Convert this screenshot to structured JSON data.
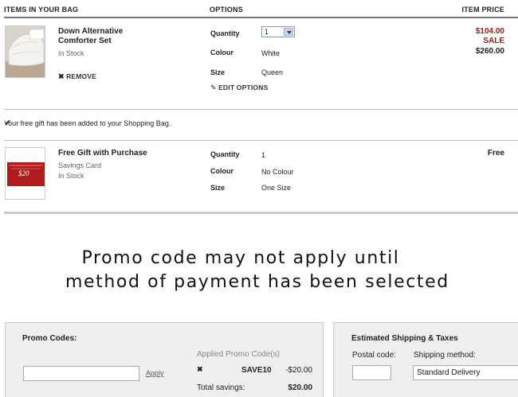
{
  "header": {
    "items_label": "ITEMS IN YOUR BAG",
    "options_label": "OPTIONS",
    "price_label": "ITEM PRICE"
  },
  "item1": {
    "name_line1": "Down Alternative",
    "name_line2": "Comforter Set",
    "stock": "In Stock",
    "remove_label": "REMOVE",
    "quantity_label": "Quantity",
    "quantity_value": "1",
    "colour_label": "Colour",
    "colour_value": "White",
    "size_label": "Size",
    "size_value": "Queen",
    "edit_label": "EDIT OPTIONS",
    "sale_price": "$104.00",
    "sale_tag": "SALE",
    "original_price": "$260.00"
  },
  "gift_notice": "Your free gift has been added to your Shopping Bag.",
  "item2": {
    "name": "Free Gift with Purchase",
    "subtitle": "Savings Card",
    "stock": "In Stock",
    "card_amount": "$20",
    "quantity_label": "Quantity",
    "quantity_value": "1",
    "colour_label": "Colour",
    "colour_value": "No Colour",
    "size_label": "Size",
    "size_value": "One Size",
    "price": "Free"
  },
  "promo_message": {
    "line1": "Promo code may not apply until",
    "line2": "method of payment has been selected"
  },
  "promo_panel": {
    "title": "Promo Codes:",
    "apply_label": "Apply",
    "applied_label": "Applied Promo Code(s)",
    "code": "SAVE10",
    "code_amount": "-$20.00",
    "savings_label": "Total savings:",
    "savings_value": "$20.00"
  },
  "shipping_panel": {
    "title": "Estimated Shipping & Taxes",
    "postal_label": "Postal code:",
    "method_label": "Shipping method:",
    "method_value": "Standard Delivery"
  },
  "colors": {
    "sale_red": "#a01818",
    "panel_bg": "#efefef"
  }
}
